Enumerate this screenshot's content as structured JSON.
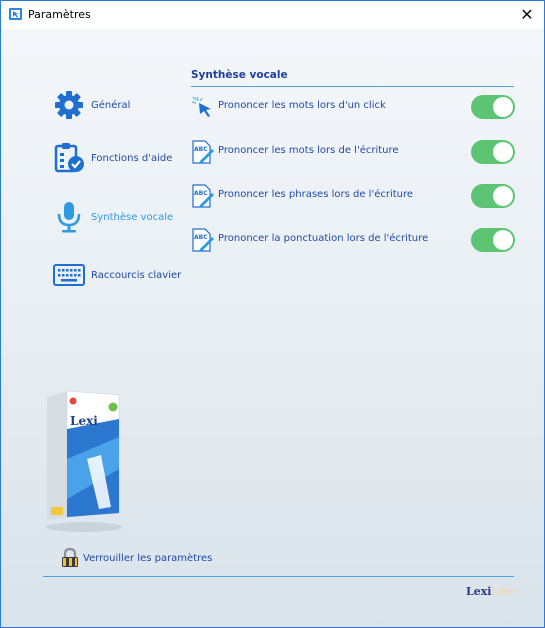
{
  "window": {
    "title": "Paramètres",
    "close_glyph": "✕"
  },
  "sidebar": {
    "items": [
      {
        "label": "Général",
        "icon": "gear-icon",
        "active": false
      },
      {
        "label": "Fonctions d'aide",
        "icon": "checklist-icon",
        "active": false
      },
      {
        "label": "Synthèse vocale",
        "icon": "microphone-icon",
        "active": true
      },
      {
        "label": "Raccourcis clavier",
        "icon": "keyboard-icon",
        "active": false
      }
    ]
  },
  "main": {
    "section_title": "Synthèse vocale",
    "options": [
      {
        "label": "Prononcer les mots lors d'un click",
        "icon": "cursor-click-icon",
        "enabled": true
      },
      {
        "label": "Prononcer les mots lors de l'écriture",
        "icon": "abc-pen-icon",
        "enabled": true
      },
      {
        "label": "Prononcer les phrases lors de l'écriture",
        "icon": "abc-pen-icon",
        "enabled": true
      },
      {
        "label": "Prononcer la ponctuation lors de l'écriture",
        "icon": "abc-pen-icon",
        "enabled": true
      }
    ]
  },
  "product": {
    "box_name": "Lexi"
  },
  "footer": {
    "lock_label": "Verrouiller les paramètres",
    "logo_main": "Lexi",
    "logo_suffix": "Lite"
  },
  "colors": {
    "accent": "#2f9ae0",
    "link_text": "#1f4aa8",
    "toggle_on": "#5cc472",
    "divider": "#4aa3e0"
  }
}
